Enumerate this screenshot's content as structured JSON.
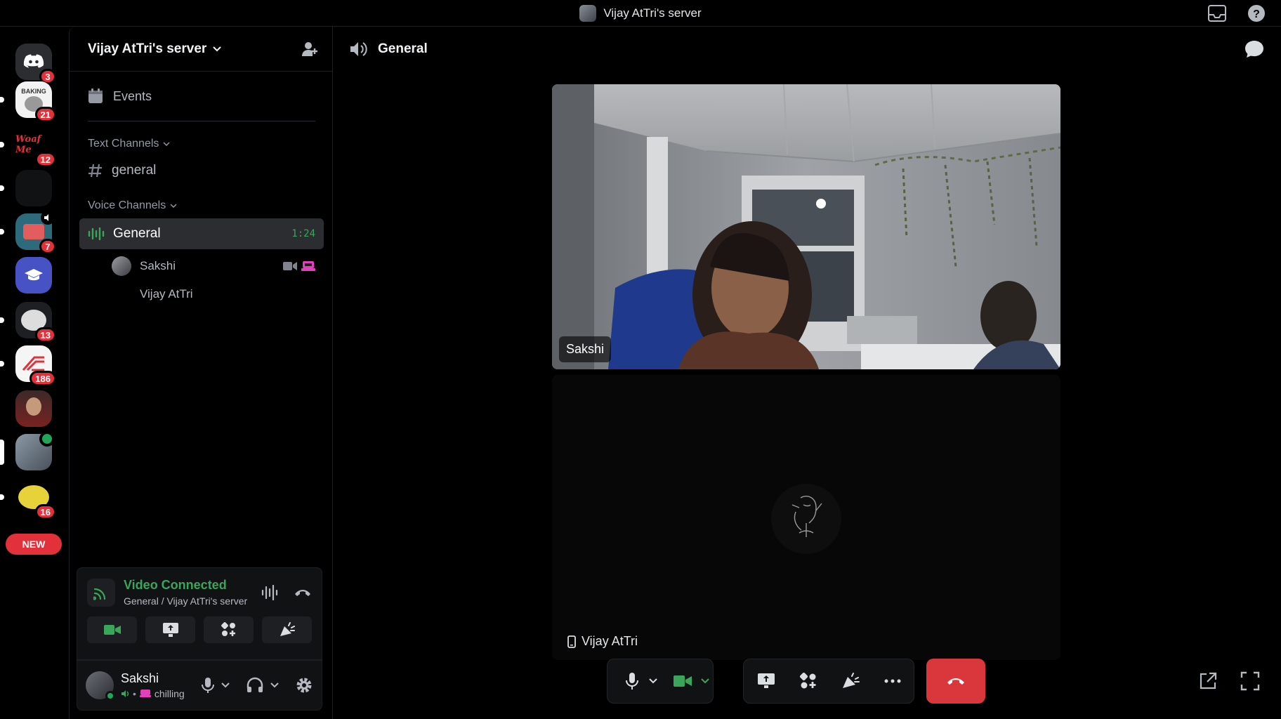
{
  "window": {
    "title": "Vijay AtTri's server"
  },
  "servers": [
    {
      "badge": "3",
      "color": "#2b2d31"
    },
    {
      "badge": "21",
      "color": "#f2f2f2",
      "label": "BAKING"
    },
    {
      "badge": "12",
      "color": "#000000",
      "label": "Woaf Me"
    },
    {
      "badge": "",
      "color": "#111214"
    },
    {
      "badge": "7",
      "color": "#2c6a7c"
    },
    {
      "badge": "",
      "color": "#4752c4"
    },
    {
      "badge": "13",
      "color": "#1e1f22"
    },
    {
      "badge": "186",
      "color": "#f5f5f5"
    },
    {
      "badge": "",
      "color": "#6b2a2a"
    },
    {
      "badge": "",
      "color": "#5a6470"
    },
    {
      "badge": "16",
      "color": "#e8d23a"
    }
  ],
  "new_label": "NEW",
  "sidebar": {
    "server_name": "Vijay AtTri's server",
    "events_label": "Events",
    "text_category": "Text Channels",
    "text_channel": "general",
    "voice_category": "Voice Channels",
    "voice_channel": "General",
    "voice_timer": "1:24",
    "members": [
      "Sakshi",
      "Vijay AtTri"
    ]
  },
  "voice_panel": {
    "status": "Video Connected",
    "location": "General / Vijay AtTri's server"
  },
  "user": {
    "name": "Sakshi",
    "status": "chilling"
  },
  "main": {
    "channel_name": "General",
    "tile1_name": "Sakshi",
    "tile2_name": "Vijay AtTri"
  },
  "colors": {
    "accent_green": "#3ba55c",
    "danger_red": "#da373c",
    "blurple": "#4752c4"
  }
}
